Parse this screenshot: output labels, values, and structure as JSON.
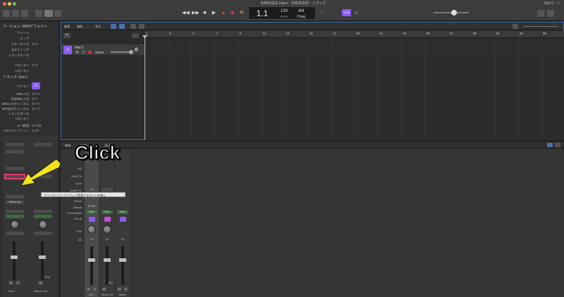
{
  "window": {
    "title": "名称未設定.logicx - 名称未設定 - トラック",
    "top_right": "簡易モード"
  },
  "lcd": {
    "bar": "1",
    "beat": "1",
    "tempo": "120",
    "tempo_label": "KEEP",
    "signature": "4/4",
    "key": "Cmaj",
    "badge": "1234"
  },
  "tracks_menu": {
    "edit": "編集",
    "function": "機能",
    "view": "表示"
  },
  "ruler": {
    "ticks": [
      "1",
      "3",
      "5",
      "7",
      "9",
      "11",
      "13",
      "15",
      "17",
      "19",
      "21",
      "23",
      "25",
      "27",
      "29",
      "31",
      "33",
      "35"
    ]
  },
  "track": {
    "name": "Inst 1"
  },
  "inspector": {
    "region_header": "リージョン: MIDIデフォルト",
    "region_rows": [
      {
        "label": "ミュート:",
        "value": ""
      },
      {
        "label": "ループ:",
        "value": ""
      },
      {
        "label": "クオンタイズ:",
        "value": "オフ"
      },
      {
        "label": "Qスウィング:",
        "value": ""
      },
      {
        "label": "トランスポーズ:",
        "value": ""
      },
      {
        "label": "ベロシティ:",
        "value": "オフ"
      },
      {
        "label": "ベロシティ:",
        "value": ""
      }
    ],
    "track_header": "トラック: Inst 1",
    "icon_label": "アイコン:",
    "track_rows": [
      {
        "label": "MIDI入力:",
        "value": "すべて"
      },
      {
        "label": "外部MIDI入力:",
        "value": "オフ"
      },
      {
        "label": "MIDI入力チャンネル:",
        "value": "すべて"
      },
      {
        "label": "MIDI出力チャンネル:",
        "value": "すべて"
      },
      {
        "label": "トランスポーズ:",
        "value": ""
      },
      {
        "label": "ベロシティ:",
        "value": ""
      },
      {
        "label": "キー範囲:",
        "value": "C-2  G8"
      },
      {
        "label": "ベロシティリミット:",
        "value": "1  127"
      }
    ],
    "strip1_name": "Inst 1",
    "strip2_name": "Stereo Out",
    "stereo_out_btn": "Stereo Out",
    "bnc_label": "Bnc"
  },
  "mixer": {
    "menu": {
      "edit": "編集",
      "options": "オプション",
      "view": "表示"
    },
    "rows": [
      "EQ",
      "MIDI FX",
      "Input",
      "Audio FX",
      "Sends",
      "Output",
      "Automation",
      "Group",
      "Pan",
      "dB"
    ],
    "output_value": "St Out",
    "read": "Read",
    "ms": {
      "m": "M",
      "s": "S",
      "d": "D"
    },
    "strips": [
      {
        "name": "Inst 1",
        "db": "0.0"
      },
      {
        "name": "Stereo Out",
        "db": "0.0"
      },
      {
        "name": "Master",
        "db": "0.0"
      }
    ],
    "bnc": "Bnc"
  },
  "annotation": {
    "click": "Click",
    "tooltip": "クリックしてソフトウェア音源プラグインを挿入"
  },
  "colors": {
    "accent": "#3d6bbd",
    "arrow": "#f2e21a",
    "highlight": "#e83a6a",
    "purple": "#8a5cf6",
    "record": "#e03c3c"
  }
}
